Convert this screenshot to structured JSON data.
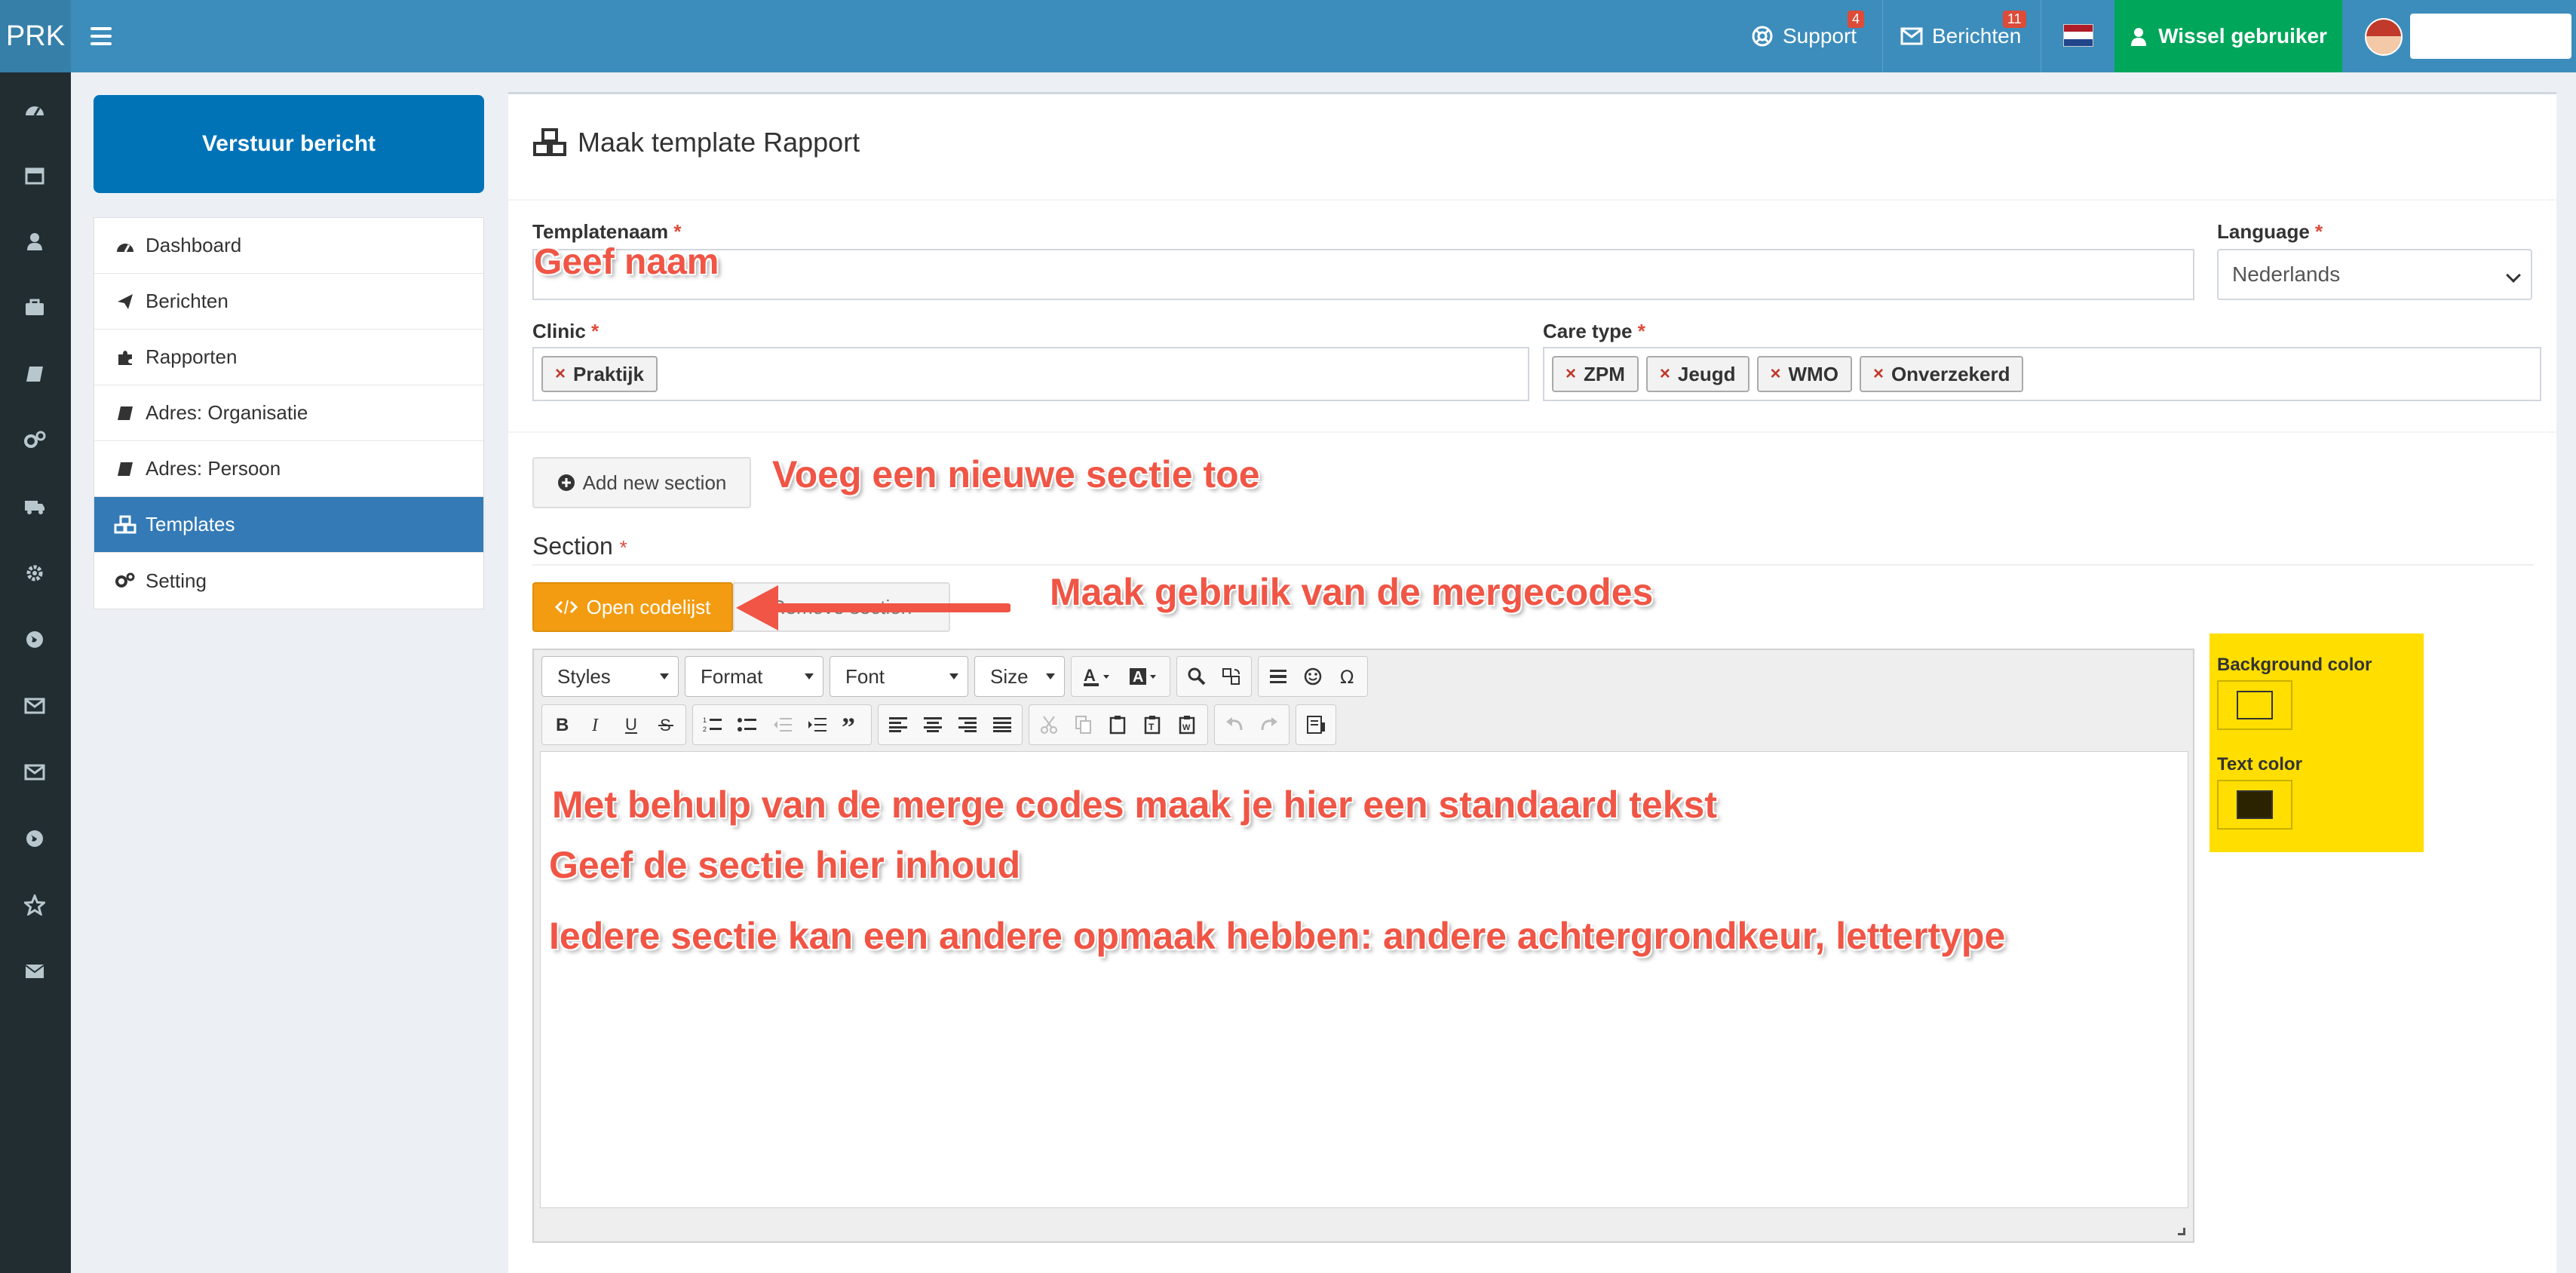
{
  "app": {
    "brand": "PRK"
  },
  "topbar": {
    "support_label": "Support",
    "support_badge": "4",
    "messages_label": "Berichten",
    "messages_badge": "11",
    "switch_user_label": "Wissel gebruiker",
    "flag_colors": [
      "#ae1c28",
      "#ffffff",
      "#21468b"
    ]
  },
  "sidebar": {
    "send_button": "Verstuur bericht",
    "items": [
      {
        "label": "Dashboard",
        "icon": "dashboard-icon",
        "active": false
      },
      {
        "label": "Berichten",
        "icon": "paper-plane-icon",
        "active": false
      },
      {
        "label": "Rapporten",
        "icon": "puzzle-icon",
        "active": false
      },
      {
        "label": "Adres: Organisatie",
        "icon": "book-icon",
        "active": false
      },
      {
        "label": "Adres: Persoon",
        "icon": "book-icon",
        "active": false
      },
      {
        "label": "Templates",
        "icon": "cubes-icon",
        "active": true
      },
      {
        "label": "Setting",
        "icon": "cogs-icon",
        "active": false
      }
    ]
  },
  "iconbar": [
    "dashboard-icon",
    "calendar-icon",
    "user-icon",
    "briefcase-icon",
    "book-icon",
    "cogs-icon",
    "truck-icon",
    "gear-icon",
    "globe-icon",
    "envelope-o-icon",
    "envelope-icon",
    "globe-icon",
    "star-icon",
    "envelope-solid-icon"
  ],
  "page": {
    "title": "Maak template Rapport",
    "form": {
      "template_name_label": "Templatenaam",
      "language_label": "Language",
      "language_value": "Nederlands",
      "clinic_label": "Clinic",
      "clinic_tags": [
        "Praktijk"
      ],
      "care_type_label": "Care type",
      "care_type_tags": [
        "ZPM",
        "Jeugd",
        "WMO",
        "Onverzekerd"
      ],
      "required_mark": "*"
    },
    "add_section_button": "Add new section",
    "section_heading": "Section",
    "open_code_list_button": "Open codelijst",
    "remove_section_button": "Remove section"
  },
  "editor": {
    "combos": [
      "Styles",
      "Format",
      "Font",
      "Size"
    ],
    "toolbar_row1_icons": [
      "text-color-icon",
      "bg-color-icon",
      "find-icon",
      "replace-icon",
      "horizontal-rule-icon",
      "smiley-icon",
      "omega-icon"
    ],
    "toolbar_row2_icons": [
      "bold-icon",
      "italic-icon",
      "underline-icon",
      "strike-icon",
      "numbered-list-icon",
      "bullet-list-icon",
      "outdent-icon",
      "indent-icon",
      "blockquote-icon",
      "align-left-icon",
      "align-center-icon",
      "align-right-icon",
      "justify-icon",
      "cut-icon",
      "copy-icon",
      "paste-icon",
      "paste-text-icon",
      "paste-word-icon",
      "undo-icon",
      "redo-icon",
      "source-icon"
    ]
  },
  "colors_panel": {
    "background_label": "Background color",
    "text_label": "Text color",
    "background_color": "#ffde00",
    "text_color_swatch": "#2b2300"
  },
  "annotations": {
    "name": "Geef naam",
    "add_section": "Voeg een nieuwe sectie toe",
    "mergecodes": "Maak gebruik van de mergecodes",
    "line1": "Met behulp van de merge codes maak je hier een standaard tekst",
    "line2": "Geef de sectie hier inhoud",
    "line3": "Iedere sectie kan een andere opmaak hebben: andere achtergrondkeur, lettertype",
    "color": "#f05545"
  },
  "colors": {
    "topbar": "#3c8dbc",
    "switch_user": "#00a65a",
    "active_menu": "#337ab7",
    "send_button": "#0073b7",
    "orange_button": "#f39c12"
  }
}
